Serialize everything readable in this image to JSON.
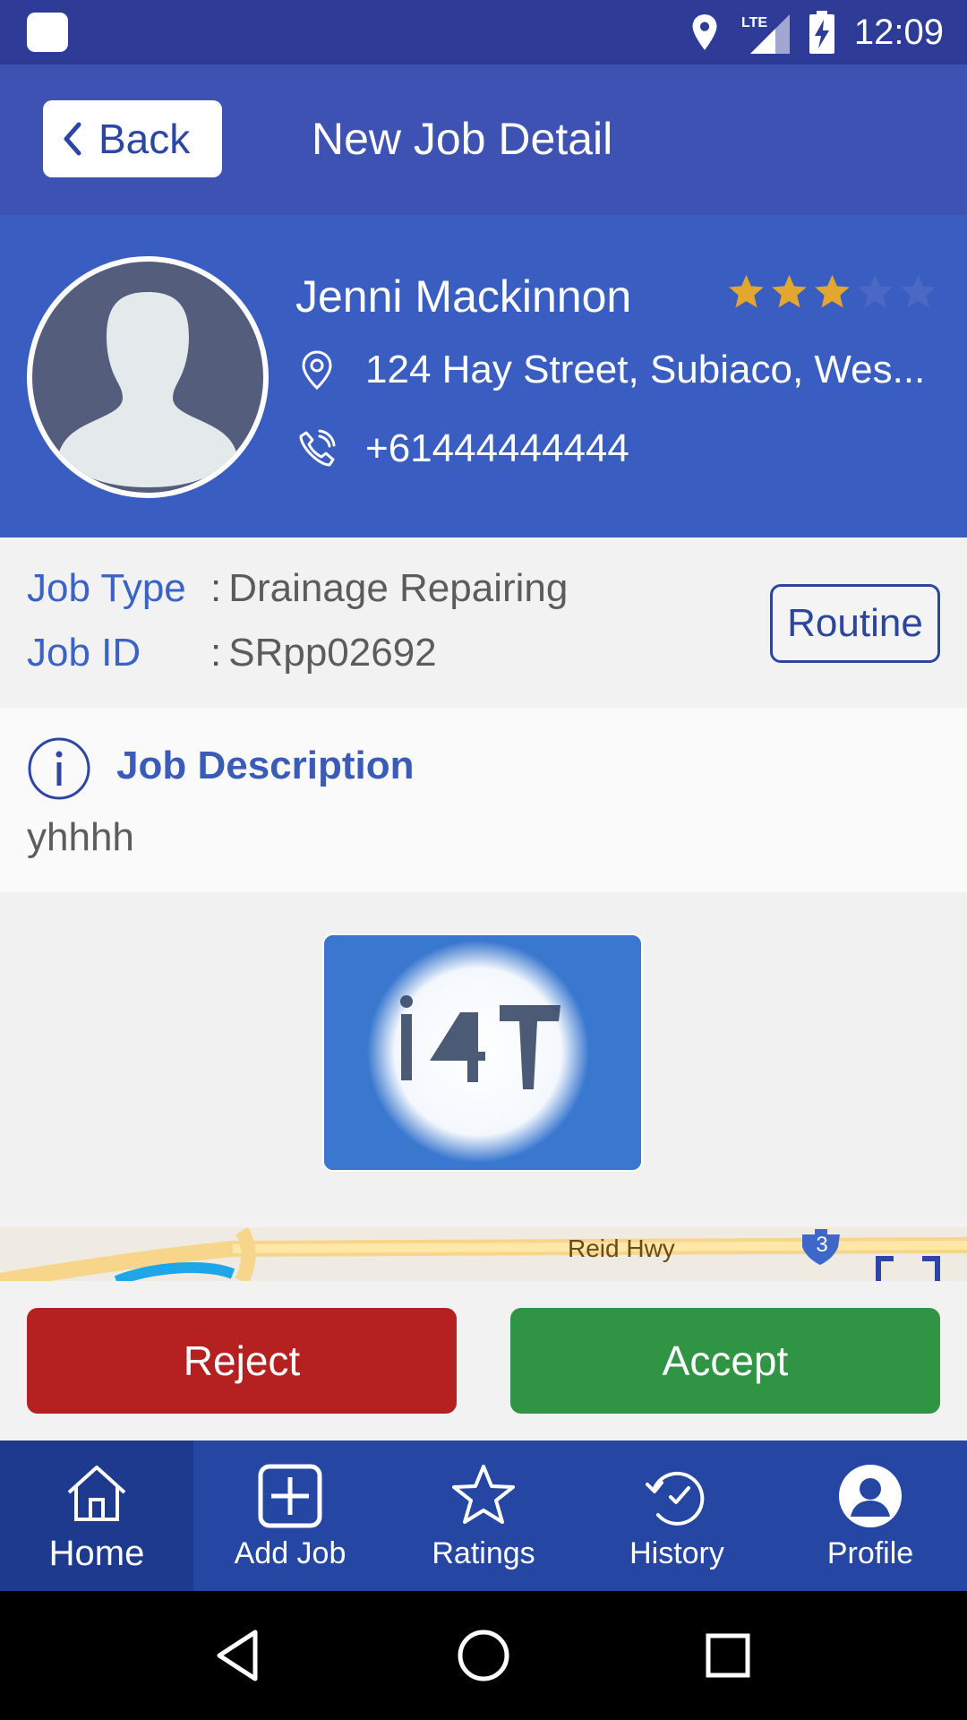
{
  "status_bar": {
    "time": "12:09",
    "network": "LTE",
    "icons": [
      "app-icon",
      "location-icon",
      "signal-icon",
      "battery-charging-icon"
    ]
  },
  "header": {
    "back_label": "Back",
    "title": "New Job Detail"
  },
  "customer": {
    "name": "Jenni Mackinnon",
    "rating": 3,
    "rating_max": 5,
    "address": "124 Hay Street, Subiaco, Wes...",
    "phone": "+61444444444"
  },
  "job": {
    "type_label": "Job Type",
    "type_value": "Drainage Repairing",
    "id_label": "Job ID",
    "id_value": "SRpp02692",
    "separator": ":",
    "priority_badge": "Routine"
  },
  "description": {
    "title": "Job Description",
    "text": "yhhhh"
  },
  "map": {
    "road_label": "Reid Hwy",
    "route_shield": "3"
  },
  "actions": {
    "reject_label": "Reject",
    "accept_label": "Accept"
  },
  "nav": {
    "items": [
      {
        "label": "Home",
        "icon": "home-icon"
      },
      {
        "label": "Add Job",
        "icon": "add-box-icon"
      },
      {
        "label": "Ratings",
        "icon": "star-icon"
      },
      {
        "label": "History",
        "icon": "history-icon"
      },
      {
        "label": "Profile",
        "icon": "profile-icon"
      }
    ]
  },
  "colors": {
    "primary": "#3e52b4",
    "profile_bg": "#3a5dc1",
    "accent_text": "#3a63c7",
    "star_filled": "#e3a72f",
    "reject": "#b52121",
    "accept": "#2f9443",
    "nav_bg": "#2546a3"
  }
}
